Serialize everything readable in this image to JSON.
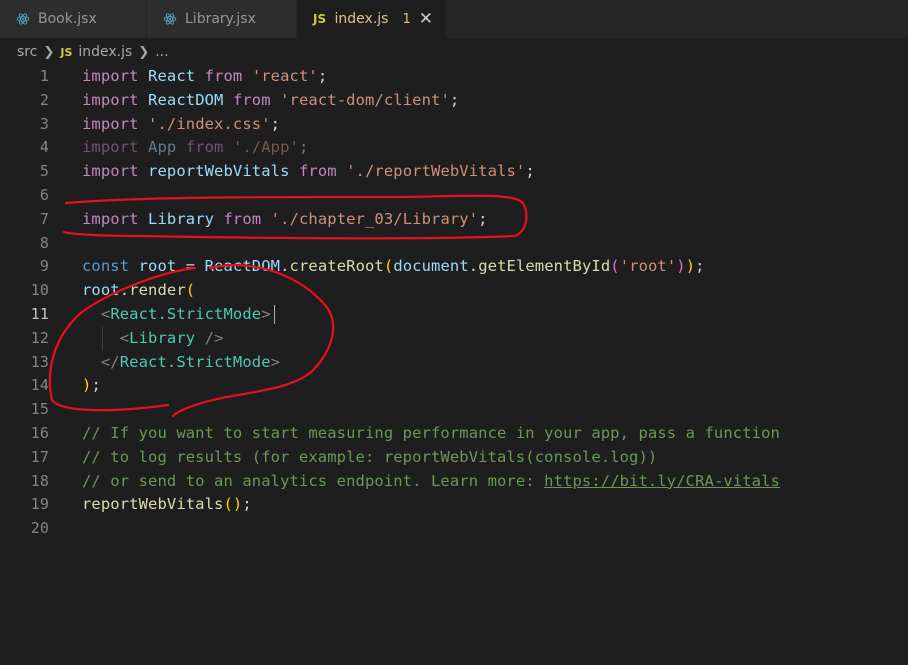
{
  "tabs": [
    {
      "label": "Book.jsx",
      "icon": "react-icon"
    },
    {
      "label": "Library.jsx",
      "icon": "react-icon"
    },
    {
      "label": "index.js",
      "icon": "js-icon",
      "problems": "1",
      "close": "✕"
    }
  ],
  "breadcrumb": {
    "folder": "src",
    "file": "index.js",
    "more": "..."
  },
  "colors": {
    "editor_bg": "#1e1e1e",
    "keyword": "#c586c0",
    "string": "#ce9178",
    "variable": "#9cdcfe",
    "function": "#dcdcaa",
    "component": "#4ec9b0",
    "comment": "#6a9955",
    "annotation": "#e8101a"
  },
  "editor": {
    "current_line": "11",
    "lines": [
      {
        "n": "1",
        "t": [
          "import",
          " ",
          "React",
          " ",
          "from",
          " ",
          "'react'",
          ";"
        ]
      },
      {
        "n": "2",
        "t": [
          "import",
          " ",
          "ReactDOM",
          " ",
          "from",
          " ",
          "'react-dom/client'",
          ";"
        ]
      },
      {
        "n": "3",
        "t": [
          "import",
          " ",
          "'./index.css'",
          ";"
        ]
      },
      {
        "n": "4",
        "t": [
          "import",
          " ",
          "App",
          " ",
          "from",
          " ",
          "'./App'",
          ";"
        ]
      },
      {
        "n": "5",
        "t": [
          "import",
          " ",
          "reportWebVitals",
          " ",
          "from",
          " ",
          "'./reportWebVitals'",
          ";"
        ]
      },
      {
        "n": "6",
        "t": []
      },
      {
        "n": "7",
        "t": [
          "import",
          " ",
          "Library",
          " ",
          "from",
          " ",
          "'./chapter_03/Library'",
          ";"
        ]
      },
      {
        "n": "8",
        "t": []
      },
      {
        "n": "9",
        "t": [
          "const",
          " ",
          "root",
          " = ",
          "ReactDOM",
          ".",
          "createRoot",
          "(",
          "document",
          ".",
          "getElementById",
          "(",
          "'root'",
          ")",
          ")",
          ";"
        ]
      },
      {
        "n": "10",
        "t": [
          "root",
          ".",
          "render",
          "("
        ]
      },
      {
        "n": "11",
        "t": [
          "  ",
          "<",
          "React.StrictMode",
          ">"
        ]
      },
      {
        "n": "12",
        "t": [
          "    ",
          "<",
          "Library",
          " />"
        ]
      },
      {
        "n": "13",
        "t": [
          "  ",
          "</",
          "React.StrictMode",
          ">"
        ]
      },
      {
        "n": "14",
        "t": [
          ")",
          ";"
        ]
      },
      {
        "n": "15",
        "t": []
      },
      {
        "n": "16",
        "t": [
          "// If you want to start measuring performance in your app, pass a function"
        ]
      },
      {
        "n": "17",
        "t": [
          "// to log results (for example: reportWebVitals(console.log))"
        ]
      },
      {
        "n": "18",
        "t": [
          "// or send to an analytics endpoint. Learn more: ",
          "https://bit.ly/CRA-vitals"
        ]
      },
      {
        "n": "19",
        "t": [
          "reportWebVitals",
          "(",
          ")",
          ";"
        ]
      },
      {
        "n": "20",
        "t": []
      }
    ]
  }
}
